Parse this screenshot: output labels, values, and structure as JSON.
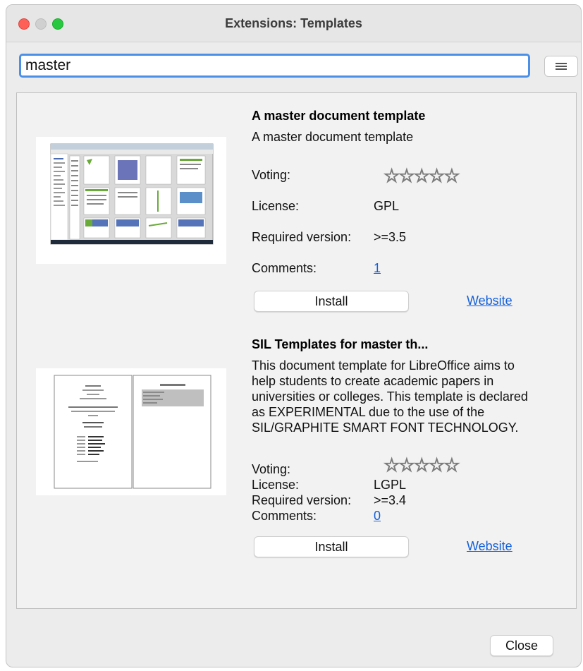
{
  "window": {
    "title": "Extensions: Templates"
  },
  "search": {
    "value": "master"
  },
  "extensions": [
    {
      "title": "A master document template",
      "description": "A master document template",
      "voting_label": "Voting:",
      "license_label": "License:",
      "license": "GPL",
      "required_version_label": "Required version:",
      "required_version": ">=3.5",
      "comments_label": "Comments:",
      "comments": "1",
      "install_label": "Install",
      "website_label": "Website",
      "rating": 0
    },
    {
      "title": "SIL Templates for master th...",
      "description": "This document template for LibreOffice aims to help students to create academic papers in universities or colleges. This template is declared as EXPERIMENTAL due to the use of the SIL/GRAPHITE SMART FONT TECHNOLOGY.",
      "voting_label": "Voting:",
      "license_label": "License:",
      "license": "LGPL",
      "required_version_label": "Required version:",
      "required_version": ">=3.4",
      "comments_label": "Comments:",
      "comments": "0",
      "install_label": "Install",
      "website_label": "Website",
      "rating": 0
    }
  ],
  "footer": {
    "close_label": "Close"
  },
  "icons": {
    "menu": "hamburger-icon",
    "star": "star-icon"
  },
  "colors": {
    "accent": "#4c8fe6",
    "link": "#1460d8",
    "close_dot": "#fe5f57",
    "max_dot": "#28c840"
  }
}
